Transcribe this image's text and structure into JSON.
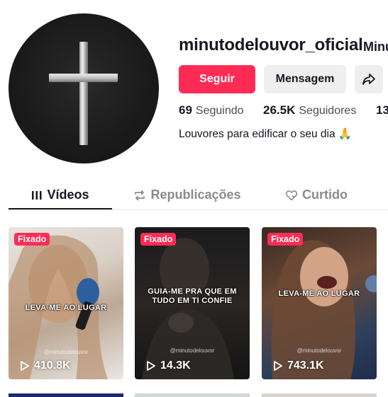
{
  "profile": {
    "username": "minutodelouvor_oficial",
    "nickname": "Minu",
    "avatar_icon": "cross-icon",
    "bio": "Louvores para edificar o seu dia 🙏"
  },
  "actions": {
    "follow_label": "Seguir",
    "message_label": "Mensagem",
    "share_icon": "share-icon"
  },
  "stats": {
    "following_count": "69",
    "following_label": "Seguindo",
    "followers_count": "26.5K",
    "followers_label": "Seguidores",
    "likes_count": "13"
  },
  "tabs": [
    {
      "label": "Vídeos",
      "icon": "grid-icon",
      "active": true
    },
    {
      "label": "Republicações",
      "icon": "repost-icon",
      "active": false
    },
    {
      "label": "Curtido",
      "icon": "heart-icon",
      "active": false
    }
  ],
  "videos": [
    {
      "pinned": "Fixado",
      "caption": "LEVA-ME AO LUGAR",
      "handle": "@minutodelouvor",
      "views": "410.8K"
    },
    {
      "pinned": "Fixado",
      "caption": "GUIA-ME PRA QUE EM TUDO EM TI CONFIE",
      "handle": "@minutodelouvor",
      "views": "14.3K"
    },
    {
      "pinned": "Fixado",
      "caption": "LEVA-ME AO LUGAR",
      "handle": "@minutodelouvor",
      "views": "743.1K"
    }
  ],
  "colors": {
    "accent": "#fe2c55",
    "text": "#161823",
    "muted": "#8a8b91",
    "button_gray": "#efefef"
  }
}
